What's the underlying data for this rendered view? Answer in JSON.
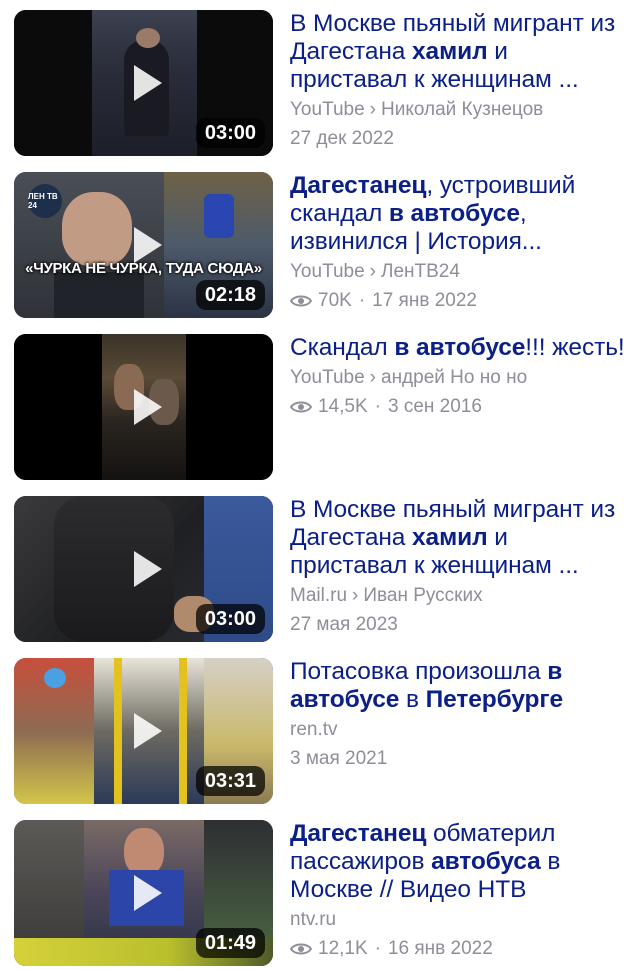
{
  "results": [
    {
      "title_parts": [
        "В Москве пьяный мигрант из Дагестана ",
        "хамил",
        " и приставал к женщинам ..."
      ],
      "source": "YouTube",
      "author": "Николай Кузнецов",
      "views": "",
      "date": "27 дек 2022",
      "duration": "03:00"
    },
    {
      "title_parts": [
        "Дагестанец",
        ", устроивший скандал ",
        "в автобусе",
        ", извинился | История..."
      ],
      "source": "YouTube",
      "author": "ЛенТВ24",
      "views": "70K",
      "date": "17 янв 2022",
      "duration": "02:18",
      "overlay_text": "«ЧУРКА НЕ ЧУРКА, ТУДА СЮДА»",
      "logo_text": "ЛЕН ТВ 24"
    },
    {
      "title_parts": [
        "Скандал ",
        "в автобусе",
        "!!! жесть!"
      ],
      "source": "YouTube",
      "author": "андрей Но но но",
      "views": "14,5K",
      "date": "3 сен 2016",
      "duration": ""
    },
    {
      "title_parts": [
        "В Москве пьяный мигрант из Дагестана ",
        "хамил",
        " и приставал к женщинам ..."
      ],
      "source": "Mail.ru",
      "author": "Иван Русских",
      "views": "",
      "date": "27 мая 2023",
      "duration": "03:00"
    },
    {
      "title_parts": [
        "Потасовка произошла ",
        "в автобусе",
        " в ",
        "Петербурге"
      ],
      "source": "ren.tv",
      "author": "",
      "views": "",
      "date": "3 мая 2021",
      "duration": "03:31"
    },
    {
      "title_parts": [
        "Дагестанец",
        " обматерил пассажиров ",
        "автобуса",
        " в Москве // Видео НТВ"
      ],
      "source": "ntv.ru",
      "author": "",
      "views": "12,1K",
      "date": "16 янв 2022",
      "duration": "01:49"
    }
  ],
  "icons": {
    "play": "play-icon",
    "views": "eye-icon"
  },
  "colors": {
    "title": "#0a1f88",
    "meta": "#8e8e99"
  }
}
